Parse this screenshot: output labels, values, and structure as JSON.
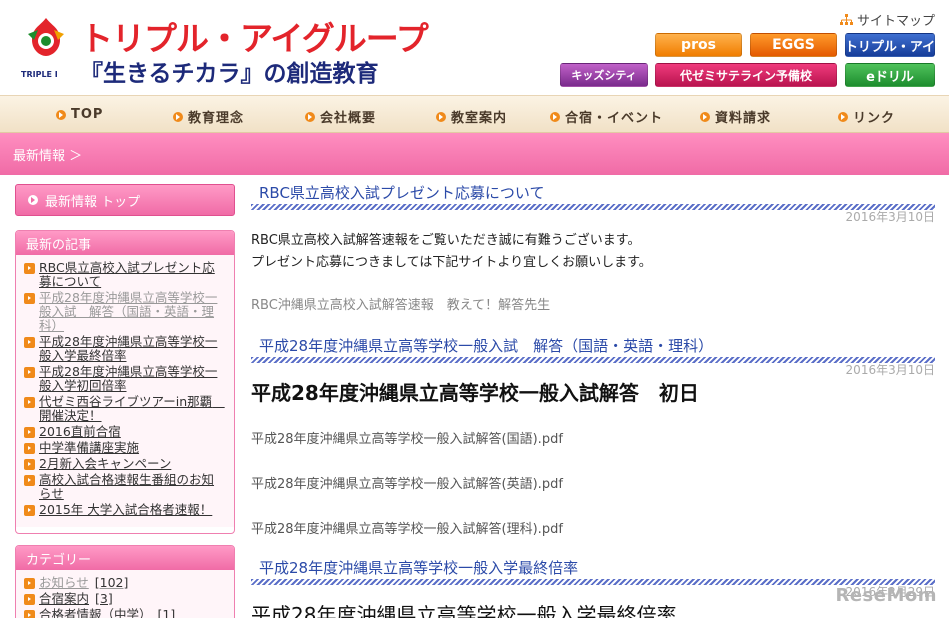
{
  "header": {
    "logo_icon": "triple-i-flame-icon",
    "logo_small_text": "TRIPLE I",
    "title": "トリプル・アイグループ",
    "subtitle": "『生きるチカラ』の創造教育",
    "sitemap_label": "サイトマップ",
    "sitemap_icon": "sitemap-icon",
    "banners": {
      "pros": "pros",
      "eggs": "EGGS",
      "triple_i": "トリプル・アイ",
      "kids": "キッズシティ",
      "yozemi": "代ゼミサテライン予備校",
      "edrill": "eドリル"
    }
  },
  "nav": {
    "items": [
      "TOP",
      "教育理念",
      "会社概要",
      "教室案内",
      "合宿・イベント",
      "資料請求",
      "リンク"
    ],
    "bullet_color": "#f08a1a"
  },
  "breadcrumb": {
    "text": "最新情報 ＞",
    "bar_color": "#f06ba6"
  },
  "sidebar": {
    "top_button": "最新情報 トップ",
    "recent": {
      "heading": "最新の記事",
      "items": [
        "RBC県立高校入試プレゼント応募について",
        "平成28年度沖縄県立高等学校一般入試　解答（国語・英語・理科）",
        "平成28年度沖縄県立高等学校一般入学最終倍率",
        "平成28年度沖縄県立高等学校一般入学初回倍率",
        "代ゼミ西谷ライブツアーin那覇　開催決定！",
        "2016直前合宿",
        "中学準備講座実施",
        "2月新入会キャンペーン",
        "高校入試合格速報生番組のお知らせ",
        "2015年 大学入試合格者速報！"
      ]
    },
    "categories": {
      "heading": "カテゴリー",
      "items": [
        {
          "label": "お知らせ",
          "count": "[102]"
        },
        {
          "label": "合宿案内",
          "count": "[3]"
        },
        {
          "label": "合格者情報（中学）",
          "count": "[1]"
        }
      ]
    }
  },
  "posts": [
    {
      "title": "RBC県立高校入試プレゼント応募について",
      "date": "2016年3月10日",
      "lines": [
        "RBC県立高校入試解答速報をご覧いただき誠に有難うございます。",
        "プレゼント応募につきましては下記サイトより宜しくお願いします。"
      ],
      "link": "RBC沖縄県立高校入試解答速報　教えて！解答先生"
    },
    {
      "title": "平成28年度沖縄県立高等学校一般入試　解答（国語・英語・理科）",
      "date": "2016年3月10日",
      "heading": "平成28年度沖縄県立高等学校一般入試解答　初日",
      "files": [
        "平成28年度沖縄県立高等学校一般入試解答(国語).pdf",
        "平成28年度沖縄県立高等学校一般入試解答(英語).pdf",
        "平成28年度沖縄県立高等学校一般入試解答(理科).pdf"
      ]
    },
    {
      "title": "平成28年度沖縄県立高等学校一般入学最終倍率",
      "date": "2016年2月29日",
      "heading": "平成28年度沖縄県立高等学校一般入学最終倍率"
    }
  ],
  "watermark": "ReseMom"
}
